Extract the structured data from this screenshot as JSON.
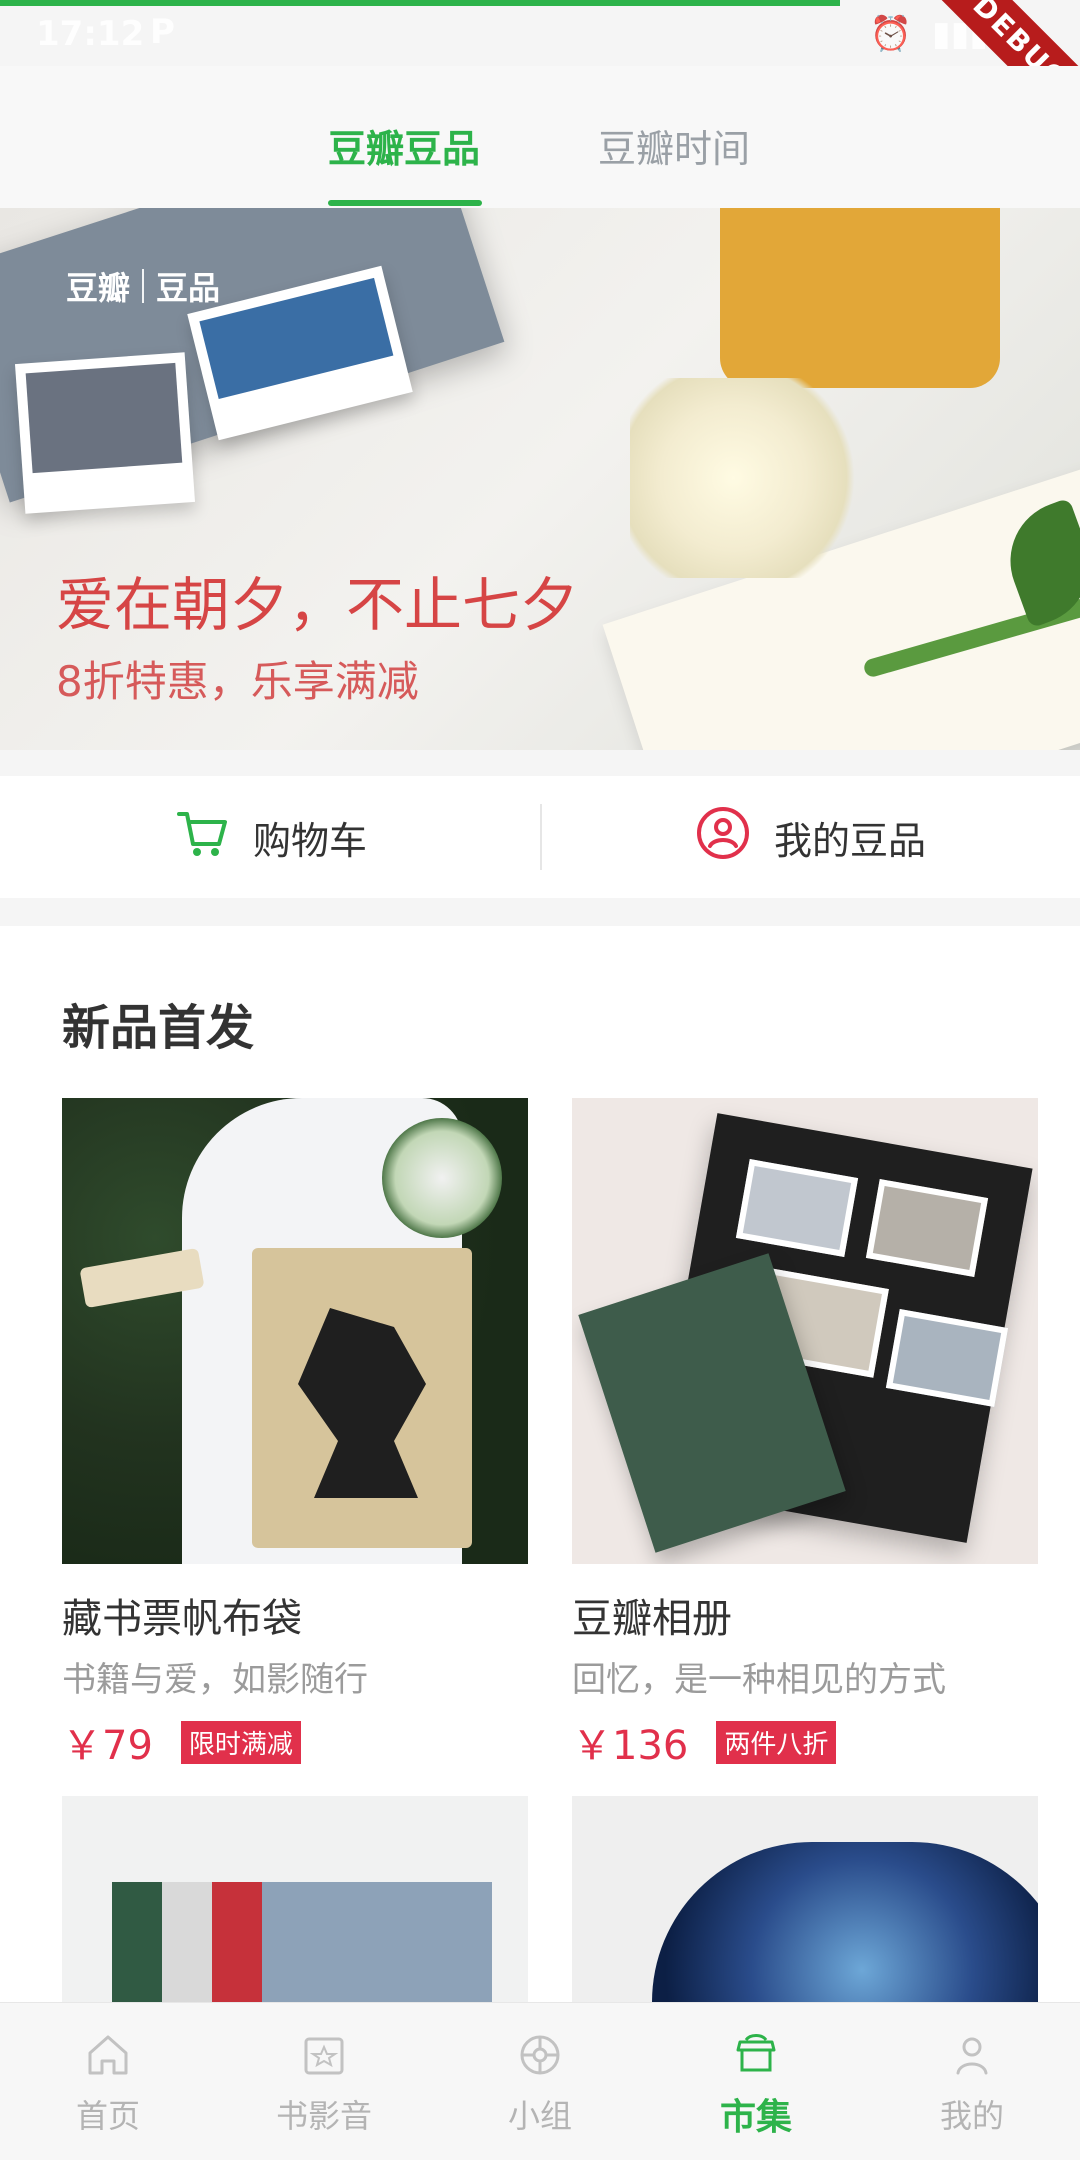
{
  "status_bar": {
    "time": "17:12",
    "p_icon": "P",
    "debug": "DEBUG"
  },
  "top_tabs": [
    {
      "label": "豆瓣豆品",
      "active": true
    },
    {
      "label": "豆瓣时间",
      "active": false
    }
  ],
  "banner": {
    "logo_left": "豆瓣",
    "logo_right": "豆品",
    "title": "爱在朝夕，不止七夕",
    "subtitle": "8折特惠，乐享满减"
  },
  "quick_actions": [
    {
      "label": "购物车",
      "icon": "cart-icon"
    },
    {
      "label": "我的豆品",
      "icon": "user-circle-icon"
    }
  ],
  "section": {
    "title": "新品首发",
    "products": [
      {
        "name": "藏书票帆布袋",
        "desc": "书籍与爱，如影随行",
        "price": "￥79",
        "tag": "限时满减"
      },
      {
        "name": "豆瓣相册",
        "desc": "回忆，是一种相见的方式",
        "price": "￥136",
        "tag": "两件八折"
      }
    ]
  },
  "bottom_nav": [
    {
      "label": "首页",
      "icon": "home-icon",
      "active": false
    },
    {
      "label": "书影音",
      "icon": "media-icon",
      "active": false
    },
    {
      "label": "小组",
      "icon": "group-icon",
      "active": false
    },
    {
      "label": "市集",
      "icon": "market-icon",
      "active": true
    },
    {
      "label": "我的",
      "icon": "profile-icon",
      "active": false
    }
  ],
  "colors": {
    "accent_green": "#2db34a",
    "price_red": "#e1304b"
  }
}
